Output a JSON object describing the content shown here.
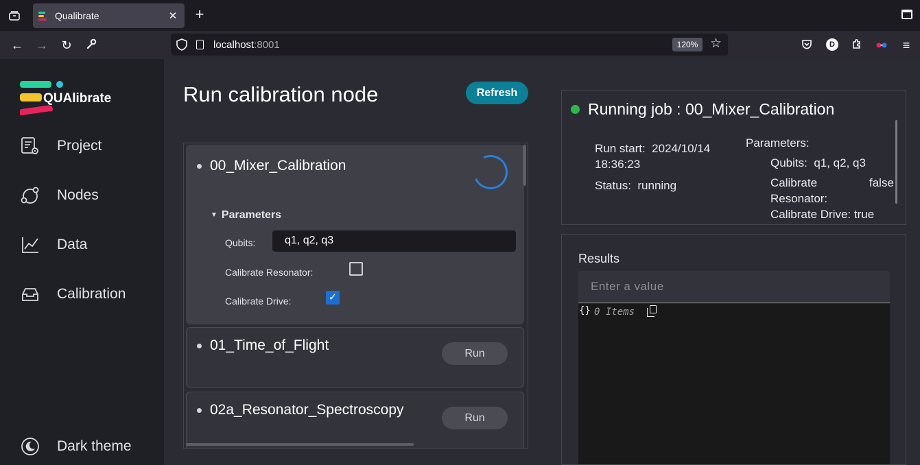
{
  "browser": {
    "tab_title": "Qualibrate",
    "url_host": "localhost",
    "url_port": ":8001",
    "zoom": "120%",
    "profile_initial": "D"
  },
  "sidebar": {
    "logo_text": "QUAlibrate",
    "items": [
      {
        "label": "Project",
        "icon": "project-settings-icon"
      },
      {
        "label": "Nodes",
        "icon": "nodes-icon"
      },
      {
        "label": "Data",
        "icon": "data-chart-icon"
      },
      {
        "label": "Calibration",
        "icon": "inbox-icon"
      }
    ],
    "theme_label": "Dark theme"
  },
  "main": {
    "title": "Run calibration node",
    "refresh_label": "Refresh",
    "nodes": [
      {
        "name": "00_Mixer_Calibration",
        "state": "running",
        "parameters_label": "Parameters",
        "params": {
          "qubits_label": "Qubits:",
          "qubits_value": "q1, q2, q3",
          "resonator_label": "Calibrate Resonator:",
          "resonator_checked": false,
          "drive_label": "Calibrate Drive:",
          "drive_checked": true
        }
      },
      {
        "name": "01_Time_of_Flight",
        "run_label": "Run"
      },
      {
        "name": "02a_Resonator_Spectroscopy",
        "run_label": "Run"
      }
    ]
  },
  "job": {
    "title_prefix": "Running job :",
    "title_name": "00_Mixer_Calibration",
    "run_start_label": "Run start:",
    "run_start_date": "2024/10/14",
    "run_start_time": "18:36:23",
    "status_label": "Status:",
    "status_value": "running",
    "params_label": "Parameters:",
    "qubits_label": "Qubits:",
    "qubits_value": "q1, q2, q3",
    "resonator_label_1": "Calibrate",
    "resonator_label_2": "Resonator:",
    "resonator_value": "false",
    "drive_label": "Calibrate Drive:",
    "drive_value": "true",
    "status_color": "#2db84d"
  },
  "results": {
    "label": "Results",
    "placeholder": "Enter a value",
    "json_brace": "{}",
    "json_count": "0 Items"
  }
}
